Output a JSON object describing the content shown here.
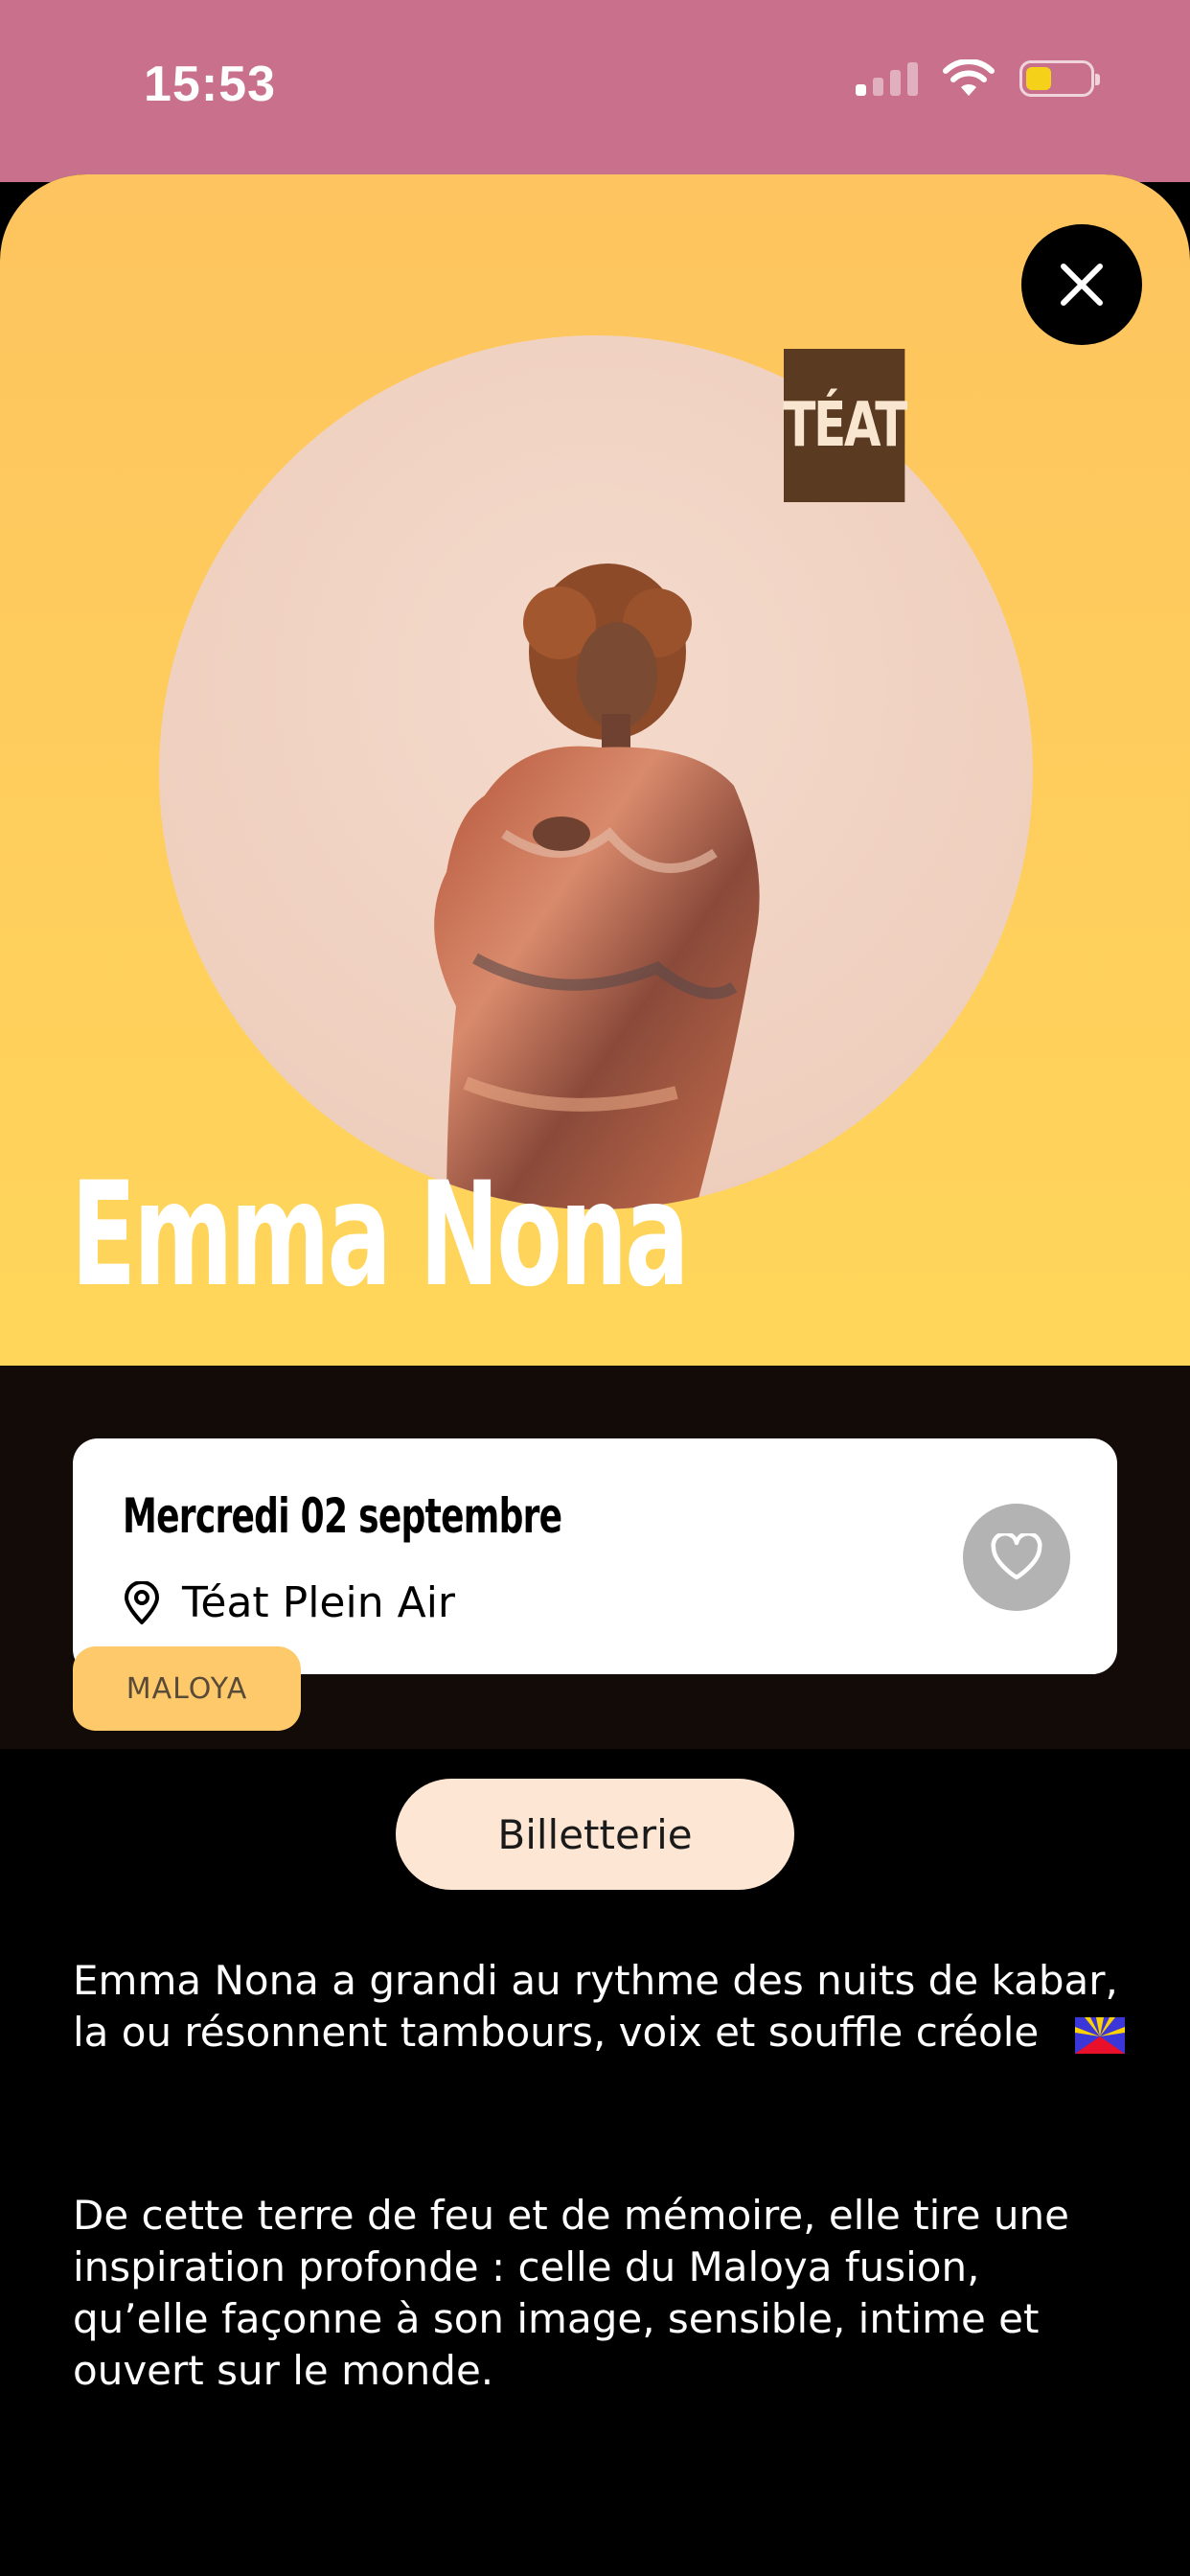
{
  "status_bar": {
    "time": "15:53"
  },
  "event": {
    "artist_name": "Emma Nona",
    "venue_logo": "TÉAT",
    "date": "Mercredi 02 septembre",
    "venue": "Téat Plein Air",
    "tag": "MALOYA",
    "ticket_label": "Billetterie",
    "description": [
      "Emma Nona a grandi au rythme des nuits de kabar, la ou résonnent tambours, voix et souffle créole",
      "De cette terre de feu et de mémoire, elle tire une inspiration profonde : celle du Maloya fusion, qu’elle façonne à son image, sensible, intime et ouvert sur le monde."
    ]
  },
  "icons": {
    "close": "close-icon",
    "location": "location-pin-icon",
    "favorite": "heart-icon",
    "flag": "reunion-flag-icon"
  },
  "colors": {
    "status_bar_bg": "#c9708d",
    "hero_gradient_top": "#fec45f",
    "hero_gradient_bottom": "#ffd65a",
    "date_band_bg": "#120b08",
    "tag_bg": "#fec96a",
    "ticket_bg": "#fee6d4",
    "favorite_bg": "#b3b3b3"
  }
}
